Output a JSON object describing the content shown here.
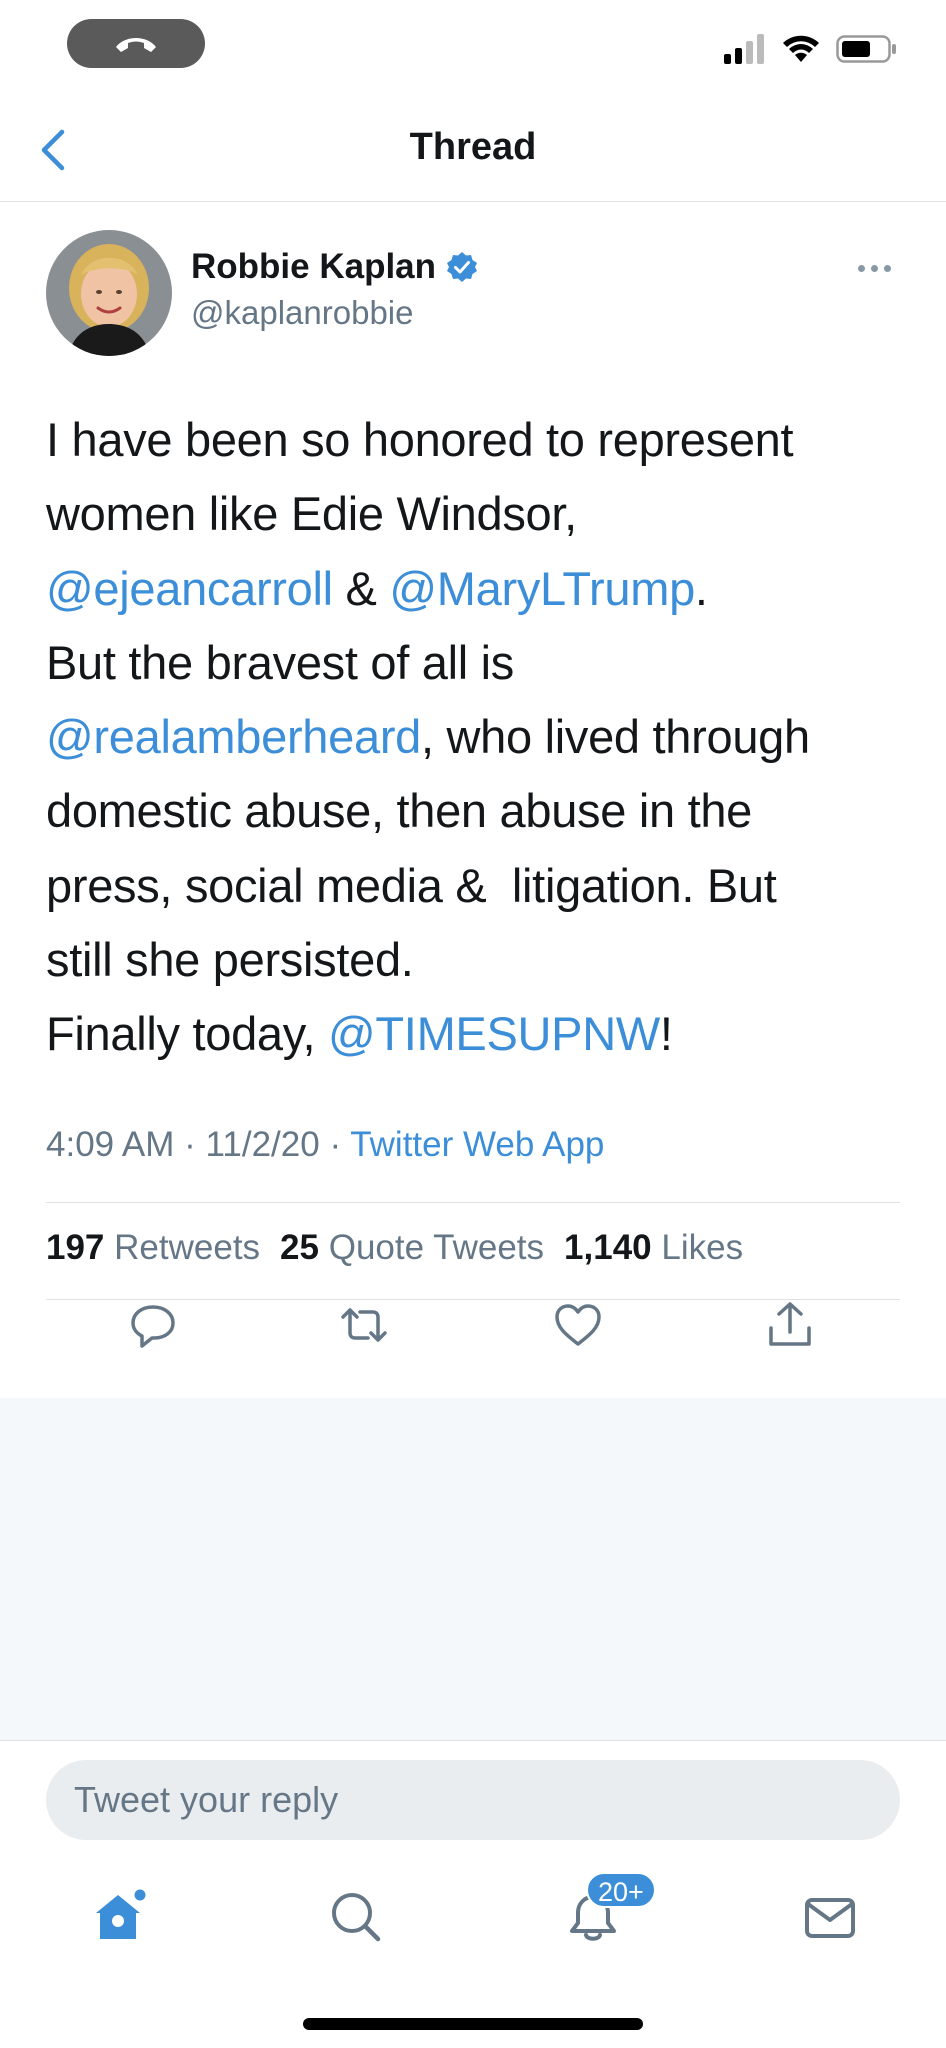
{
  "header": {
    "title": "Thread"
  },
  "tweet": {
    "author_name": "Robbie Kaplan",
    "author_handle": "@kaplanrobbie",
    "text_lines": [
      [
        {
          "t": "I have been so honored to represent",
          "m": false
        }
      ],
      [
        {
          "t": "women like Edie Windsor,",
          "m": false
        }
      ],
      [
        {
          "t": "@ejeancarroll",
          "m": true
        },
        {
          "t": " & ",
          "m": false
        },
        {
          "t": "@MaryLTrump",
          "m": true
        },
        {
          "t": ".",
          "m": false
        }
      ],
      [
        {
          "t": "But the bravest of all is",
          "m": false
        }
      ],
      [
        {
          "t": "@realamberheard",
          "m": true
        },
        {
          "t": ", who lived through",
          "m": false
        }
      ],
      [
        {
          "t": "domestic abuse, then abuse in the",
          "m": false
        }
      ],
      [
        {
          "t": "press, social media &  litigation. But",
          "m": false
        }
      ],
      [
        {
          "t": "still she persisted.",
          "m": false
        }
      ],
      [
        {
          "t": "Finally today, ",
          "m": false
        },
        {
          "t": "@TIMESUPNW",
          "m": true
        },
        {
          "t": "!",
          "m": false
        }
      ]
    ],
    "time": "4:09 AM",
    "date": "11/2/20",
    "source": "Twitter Web App",
    "retweets_count": "197",
    "retweets_label": "Retweets",
    "quotes_count": "25",
    "quotes_label": "Quote Tweets",
    "likes_count": "1,140",
    "likes_label": "Likes"
  },
  "reply": {
    "placeholder": "Tweet your reply"
  },
  "tabbar": {
    "notifications_badge": "20+"
  },
  "colors": {
    "accent": "#3b8ed7",
    "secondary_text": "#657786",
    "background_gray": "#f5f8fa"
  }
}
